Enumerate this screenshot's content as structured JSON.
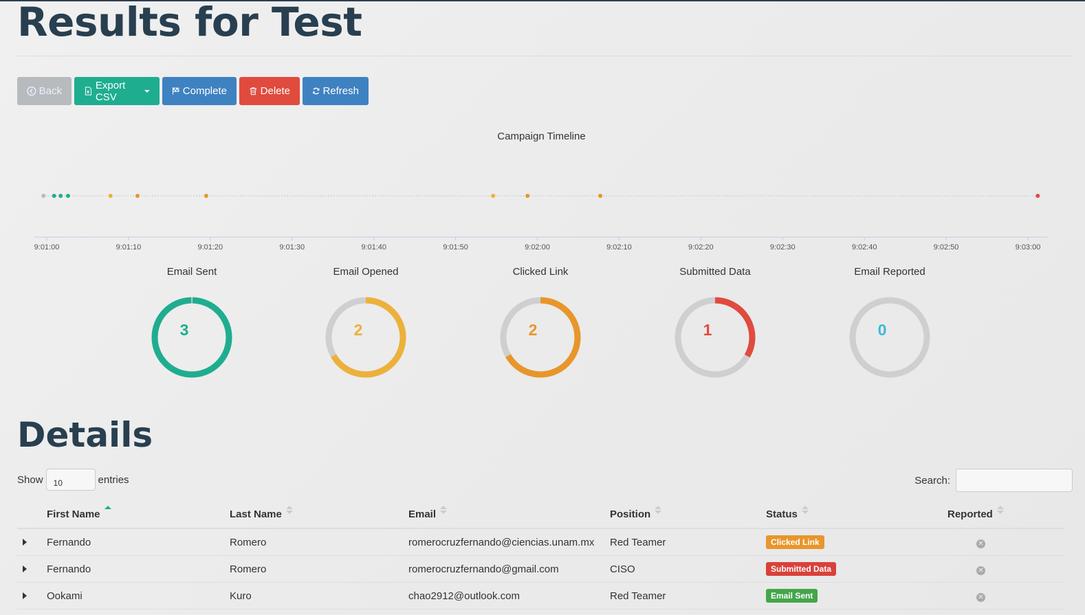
{
  "page": {
    "title": "Results for Test",
    "details_heading": "Details"
  },
  "toolbar": {
    "back": "Back",
    "export": "Export CSV",
    "complete": "Complete",
    "delete": "Delete",
    "refresh": "Refresh"
  },
  "timeline": {
    "title": "Campaign Timeline",
    "ticks": [
      "9:01:00",
      "9:01:10",
      "9:01:20",
      "9:01:30",
      "9:01:40",
      "9:01:50",
      "9:02:00",
      "9:02:10",
      "9:02:20",
      "9:02:30",
      "9:02:40",
      "9:02:50",
      "9:03:00"
    ],
    "events": [
      {
        "t": 59.6,
        "color": "#bbbbbb"
      },
      {
        "t": 60.9,
        "color": "#1fad90"
      },
      {
        "t": 61.7,
        "color": "#1fad90"
      },
      {
        "t": 62.6,
        "color": "#1fad90"
      },
      {
        "t": 67.8,
        "color": "#ecb13a"
      },
      {
        "t": 71.1,
        "color": "#e8962b"
      },
      {
        "t": 79.5,
        "color": "#e8962b"
      },
      {
        "t": 114.6,
        "color": "#ecb13a"
      },
      {
        "t": 118.8,
        "color": "#e8962b"
      },
      {
        "t": 127.7,
        "color": "#e8962b"
      },
      {
        "t": 181.2,
        "color": "#e04b3e"
      }
    ]
  },
  "stats": [
    {
      "label": "Email Sent",
      "value": "3",
      "fraction": 1.0,
      "color": "#1fad90"
    },
    {
      "label": "Email Opened",
      "value": "2",
      "fraction": 0.667,
      "color": "#ecb13a"
    },
    {
      "label": "Clicked Link",
      "value": "2",
      "fraction": 0.667,
      "color": "#e8962b"
    },
    {
      "label": "Submitted Data",
      "value": "1",
      "fraction": 0.333,
      "color": "#e04b3e"
    },
    {
      "label": "Email Reported",
      "value": "0",
      "fraction": 0.0,
      "color": "#3fb8d7"
    }
  ],
  "table_controls": {
    "show": "Show",
    "entries_value": "10",
    "entries": "entries",
    "search": "Search:"
  },
  "table": {
    "headers": [
      "First Name",
      "Last Name",
      "Email",
      "Position",
      "Status",
      "Reported"
    ],
    "rows": [
      {
        "first": "Fernando",
        "last": "Romero",
        "email": "romerocruzfernando@ciencias.unam.mx",
        "position": "Red Teamer",
        "status": "Clicked Link",
        "status_color": "#e8962b"
      },
      {
        "first": "Fernando",
        "last": "Romero",
        "email": "romerocruzfernando@gmail.com",
        "position": "CISO",
        "status": "Submitted Data",
        "status_color": "#d9413a"
      },
      {
        "first": "Ookami",
        "last": "Kuro",
        "email": "chao2912@outlook.com",
        "position": "Red Teamer",
        "status": "Email Sent",
        "status_color": "#43a64a"
      }
    ]
  }
}
